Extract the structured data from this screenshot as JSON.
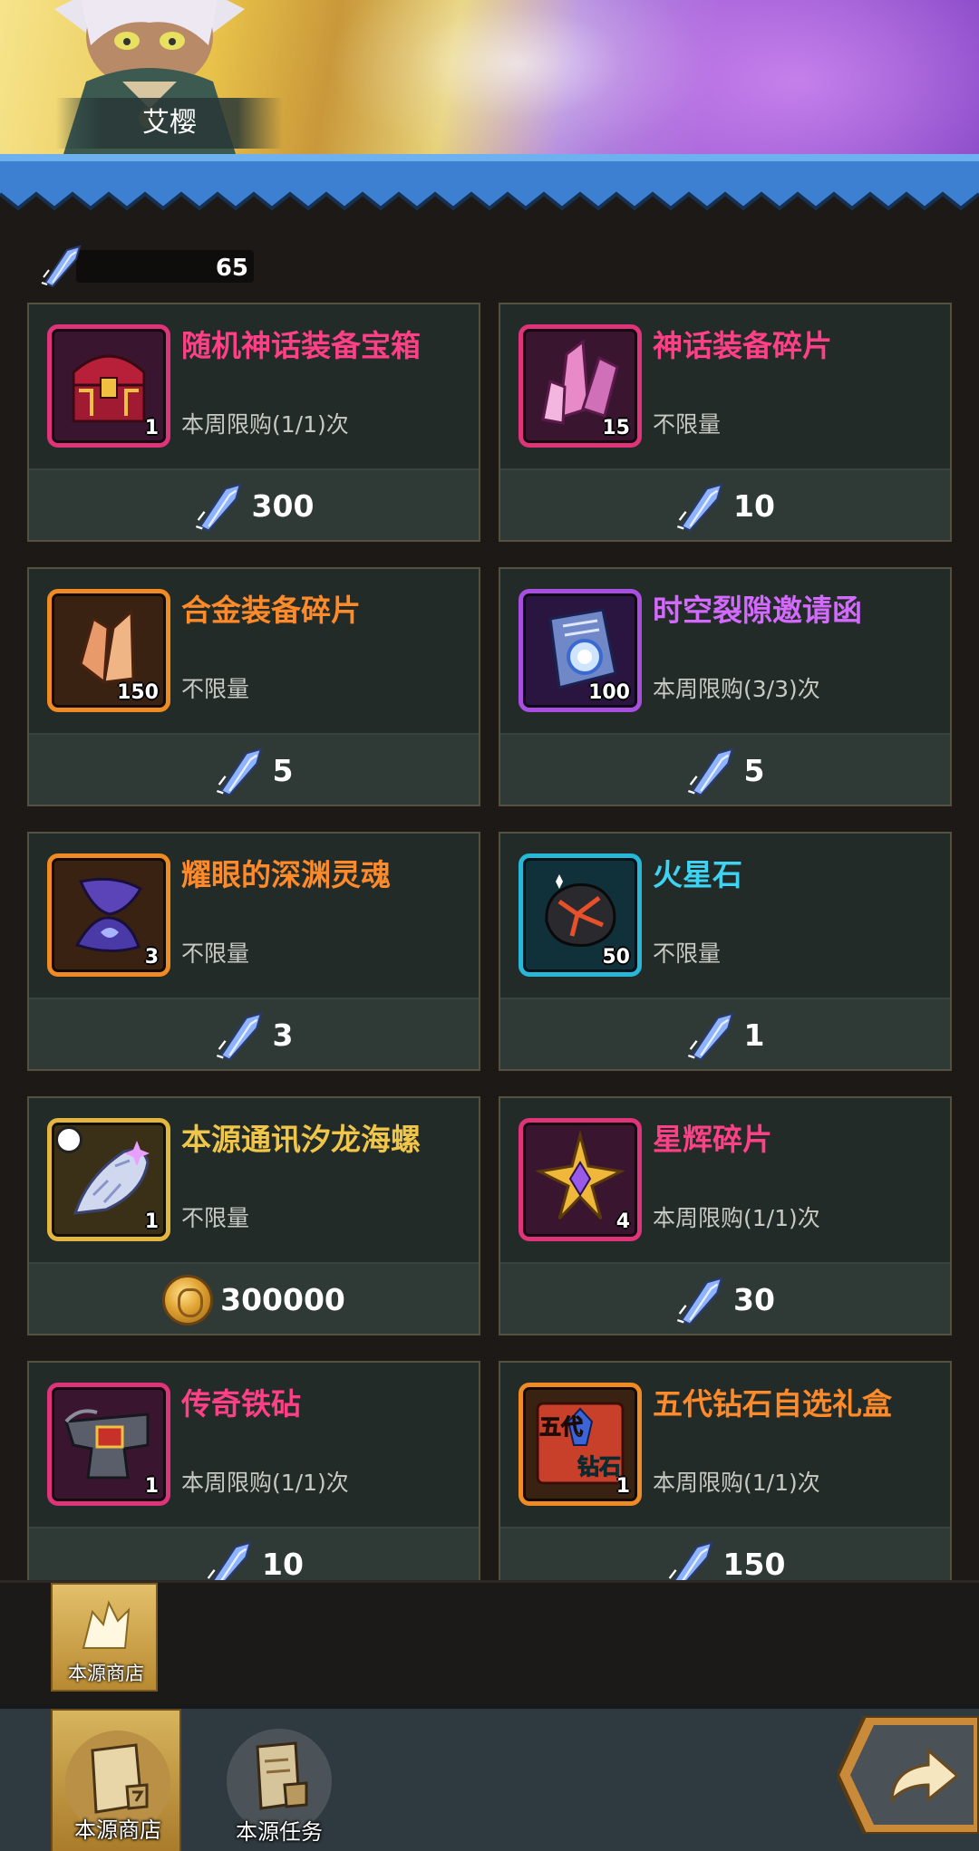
{
  "hero": {
    "name": "艾樱"
  },
  "currency": {
    "icon": "crystal-shard-icon",
    "amount": "65"
  },
  "items": [
    {
      "title": "随机神话装备宝箱",
      "rarity": "red",
      "qty": "1",
      "limit": "本周限购(1/1)次",
      "icon": "treasure-chest-icon",
      "price_icon": "crystal-shard-icon",
      "price": "300"
    },
    {
      "title": "神话装备碎片",
      "rarity": "red",
      "qty": "15",
      "limit": "不限量",
      "icon": "crystal-cluster-icon",
      "price_icon": "crystal-shard-icon",
      "price": "10"
    },
    {
      "title": "合金装备碎片",
      "rarity": "orange",
      "qty": "150",
      "limit": "不限量",
      "icon": "alloy-shard-icon",
      "price_icon": "crystal-shard-icon",
      "price": "5"
    },
    {
      "title": "时空裂隙邀请函",
      "rarity": "purple",
      "qty": "100",
      "limit": "本周限购(3/3)次",
      "icon": "invitation-scroll-icon",
      "price_icon": "crystal-shard-icon",
      "price": "5"
    },
    {
      "title": "耀眼的深渊灵魂",
      "rarity": "orange",
      "qty": "3",
      "limit": "不限量",
      "icon": "abyss-soul-icon",
      "price_icon": "crystal-shard-icon",
      "price": "3"
    },
    {
      "title": "火星石",
      "rarity": "cyan",
      "qty": "50",
      "limit": "不限量",
      "icon": "mars-stone-icon",
      "price_icon": "crystal-shard-icon",
      "price": "1"
    },
    {
      "title": "本源通讯汐龙海螺",
      "rarity": "gold",
      "qty": "1",
      "limit": "不限量",
      "icon": "sea-conch-icon",
      "price_icon": "gold-coin-icon",
      "price": "300000"
    },
    {
      "title": "星辉碎片",
      "rarity": "red",
      "qty": "4",
      "limit": "本周限购(1/1)次",
      "icon": "star-shard-icon",
      "price_icon": "crystal-shard-icon",
      "price": "30"
    },
    {
      "title": "传奇铁砧",
      "rarity": "red",
      "qty": "1",
      "limit": "本周限购(1/1)次",
      "icon": "anvil-icon",
      "price_icon": "crystal-shard-icon",
      "price": "10"
    },
    {
      "title": "五代钻石自选礼盒",
      "rarity": "orange",
      "qty": "1",
      "limit": "本周限购(1/1)次",
      "icon": "diamond-gift-box-icon",
      "icon_text_left": "五代",
      "icon_text_right": "钻石",
      "price_icon": "crystal-shard-icon",
      "price": "150"
    }
  ],
  "sub_tabs": [
    {
      "label": "本源商店",
      "icon": "origin-shop-icon"
    }
  ],
  "nav": [
    {
      "label": "本源商店",
      "icon": "scroll-icon",
      "active": true
    },
    {
      "label": "本源任务",
      "icon": "scroll-icon",
      "active": false
    }
  ],
  "back_button": {
    "icon": "return-arrow-icon"
  },
  "colors": {
    "red": "#ff3f86",
    "orange": "#ff8a2a",
    "purple": "#d469ff",
    "cyan": "#3fd3f3",
    "gold": "#f0c64a",
    "currency_blue": "#8fb4ff"
  }
}
